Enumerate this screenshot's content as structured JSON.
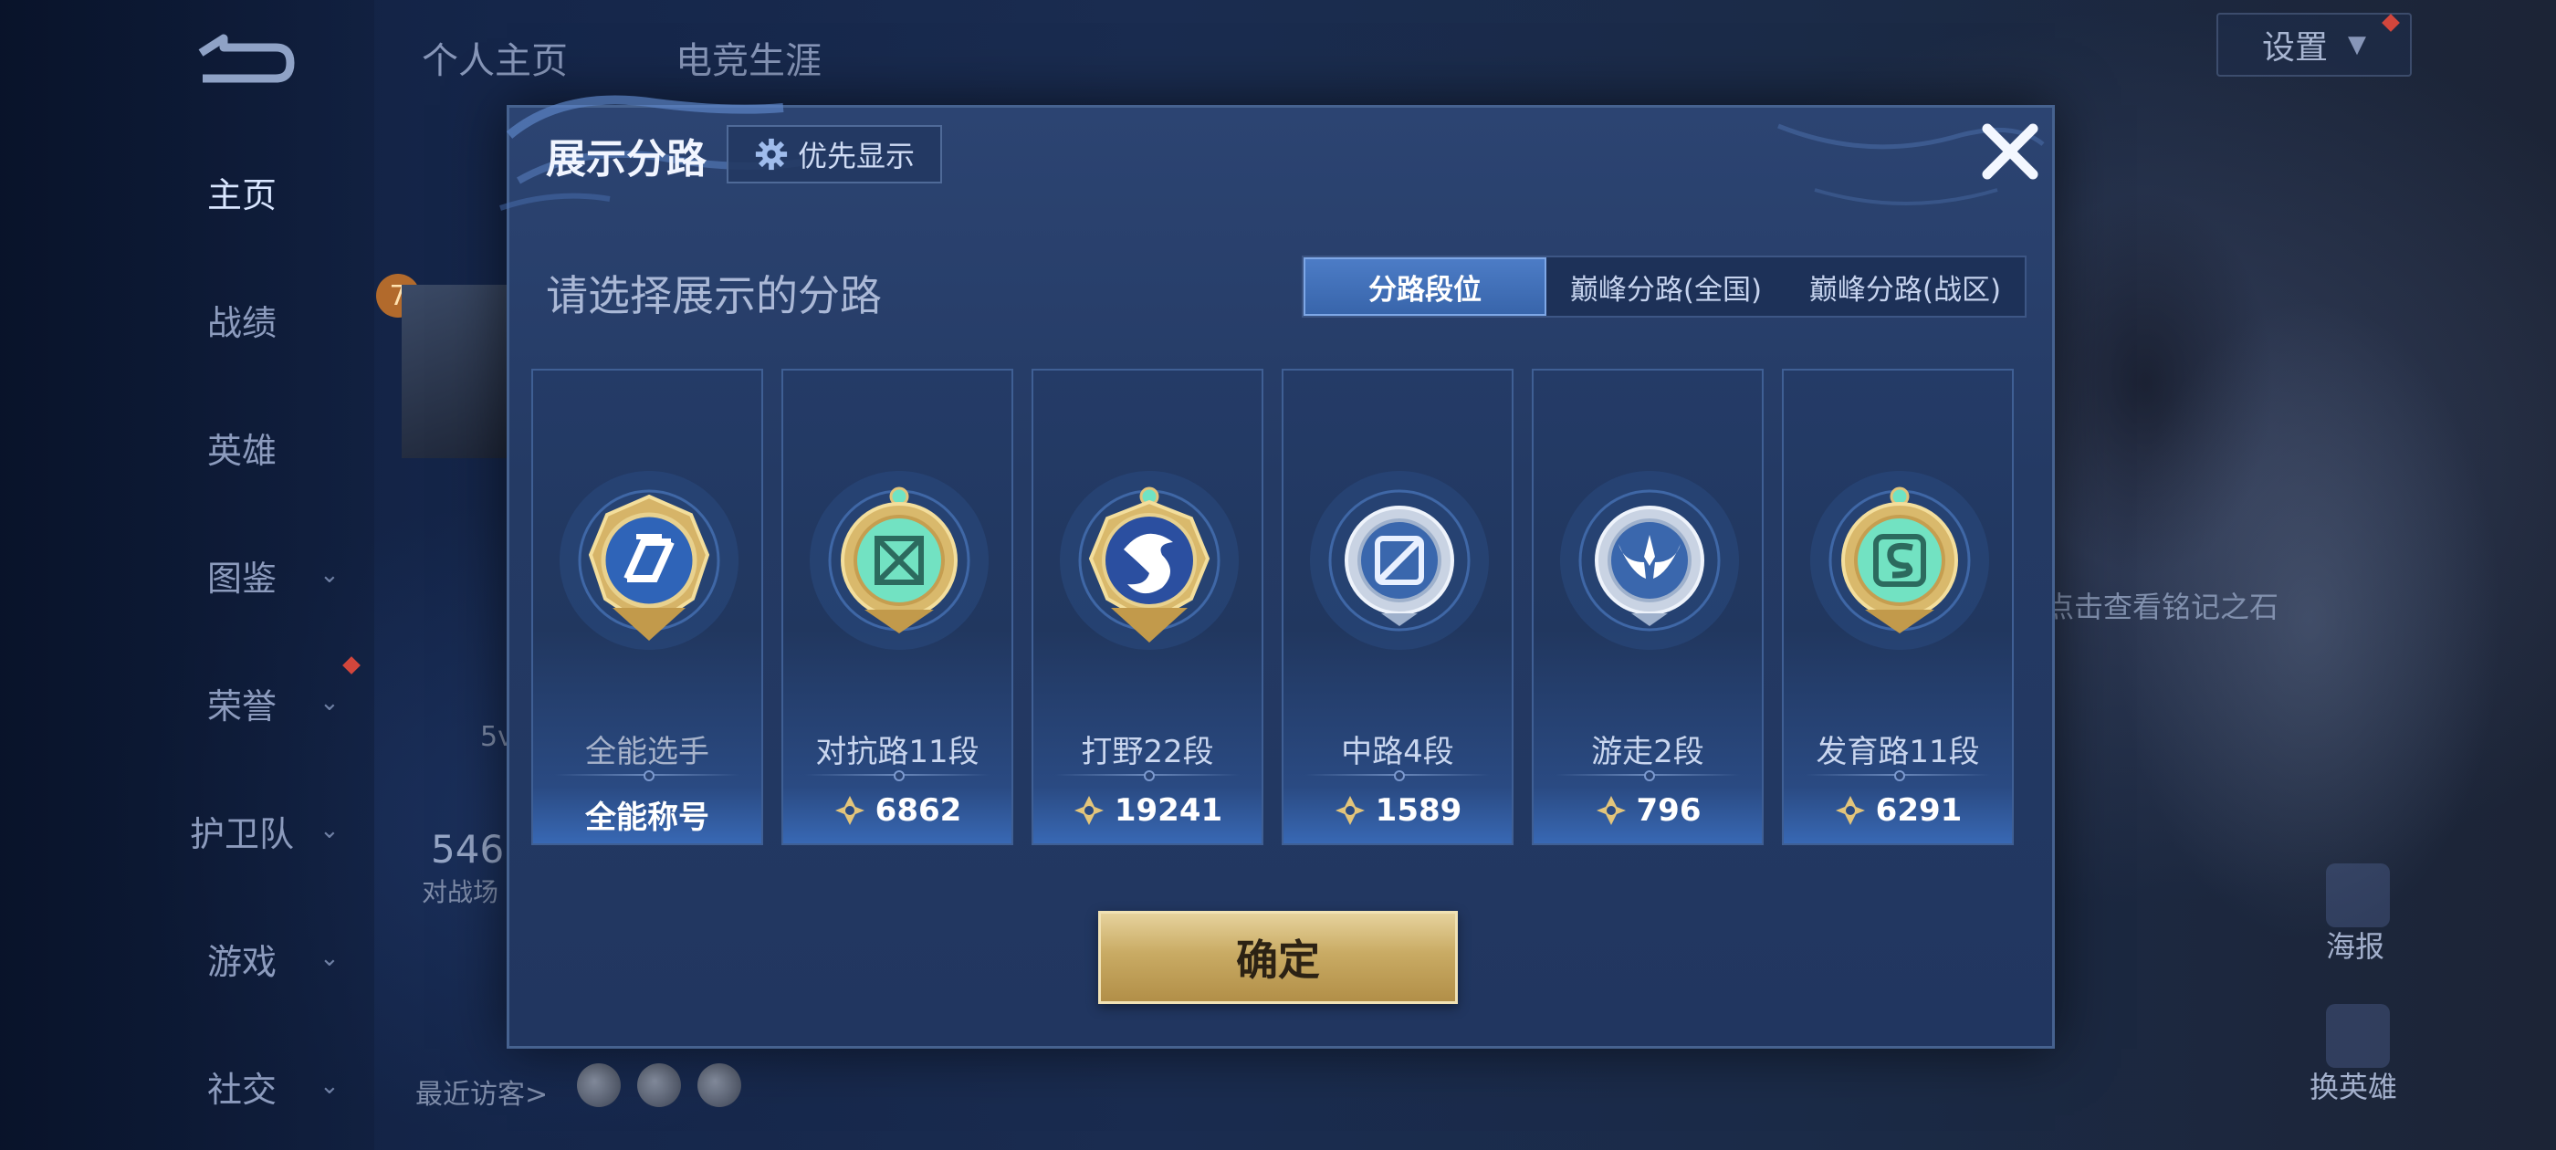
{
  "background": {
    "top_tabs": [
      "个人主页",
      "电竞生涯"
    ],
    "settings_label": "设置",
    "nav_items": [
      {
        "label": "主页",
        "active": true,
        "chevron": false
      },
      {
        "label": "战绩",
        "active": false,
        "chevron": false
      },
      {
        "label": "英雄",
        "active": false,
        "chevron": false
      },
      {
        "label": "图鉴",
        "active": false,
        "chevron": true
      },
      {
        "label": "荣誉",
        "active": false,
        "chevron": true
      },
      {
        "label": "护卫队",
        "active": false,
        "chevron": true
      },
      {
        "label": "游戏",
        "active": false,
        "chevron": true
      },
      {
        "label": "社交",
        "active": false,
        "chevron": true
      }
    ],
    "chevron_glyph": "⌄",
    "level_badge": "7",
    "partial_text_5v": "5v",
    "partial_count": "546",
    "partial_count_label": "对战场",
    "recent_visitors_label": "最近访客>",
    "rune_hint": "点击查看铭记之石",
    "right_buttons": [
      "海报",
      "换英雄"
    ]
  },
  "modal": {
    "title": "展示分路",
    "priority_button": "优先显示",
    "subtitle": "请选择展示的分路",
    "tabs": [
      {
        "label": "分路段位",
        "active": true
      },
      {
        "label": "巅峰分路(全国)",
        "active": false
      },
      {
        "label": "巅峰分路(战区)",
        "active": false
      }
    ],
    "cards": [
      {
        "name": "全能选手",
        "value": "全能称号",
        "emblem": "all-round-emblem-icon",
        "has_score_icon": false
      },
      {
        "name": "对抗路11段",
        "value": "6862",
        "emblem": "clash-lane-emblem-icon",
        "has_score_icon": true
      },
      {
        "name": "打野22段",
        "value": "19241",
        "emblem": "jungle-emblem-icon",
        "has_score_icon": true
      },
      {
        "name": "中路4段",
        "value": "1589",
        "emblem": "mid-lane-emblem-icon",
        "has_score_icon": true
      },
      {
        "name": "游走2段",
        "value": "796",
        "emblem": "roam-emblem-icon",
        "has_score_icon": true
      },
      {
        "name": "发育路11段",
        "value": "6291",
        "emblem": "farm-lane-emblem-icon",
        "has_score_icon": true
      }
    ],
    "confirm_button": "确定"
  },
  "colors": {
    "gold": "#e3c57b",
    "silver": "#c9d3e3",
    "accent_blue": "#3e6fb8",
    "jade": "#6fe3c4"
  }
}
